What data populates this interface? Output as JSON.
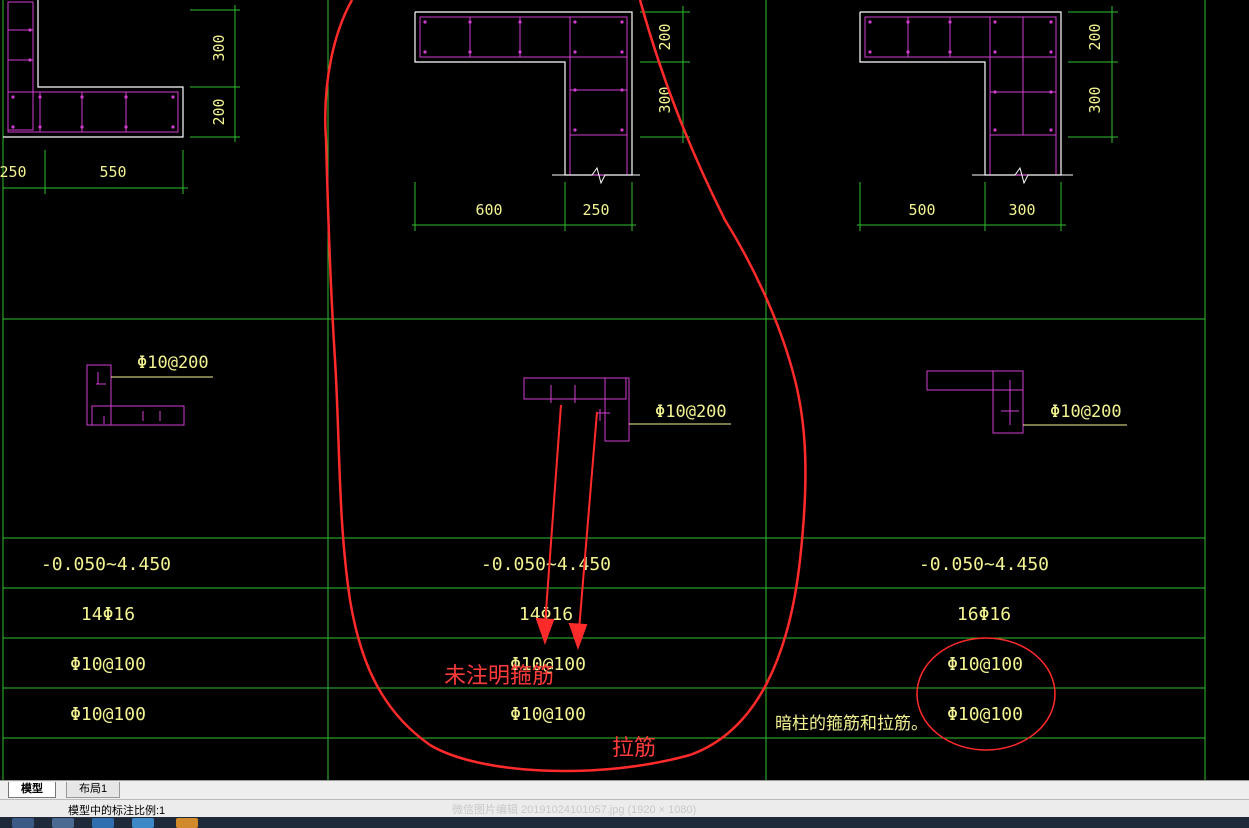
{
  "drawing": {
    "dimensions": {
      "col1": {
        "d300": "300",
        "d200": "200",
        "d250": "250",
        "d550": "550"
      },
      "col2": {
        "d200": "200",
        "d300": "300",
        "d600": "600",
        "d250": "250"
      },
      "col3": {
        "d200": "200",
        "d300": "300",
        "d500": "500",
        "d300b": "300"
      }
    },
    "stirrup_labels": [
      "Φ10@200",
      "Φ10@200",
      "Φ10@200"
    ],
    "table": {
      "elevation": [
        "-0.050~4.450",
        "-0.050~4.450",
        "-0.050~4.450"
      ],
      "longitudinal": [
        "14Φ16",
        "14Φ16",
        "16Φ16"
      ],
      "stirrup": [
        "Φ10@100",
        "Φ10@100",
        "Φ10@100"
      ],
      "tie": [
        "Φ10@100",
        "Φ10@100",
        "Φ10@100"
      ]
    },
    "annotations": {
      "unmarked_stirrup": "未注明箍筋",
      "tie_bar": "拉筋",
      "hidden_column_note": "暗柱的箍筋和拉筋。"
    },
    "colors": {
      "background": "#000000",
      "grid": "#2fbf2f",
      "rebar": "#d23cd2",
      "outline": "#ffffff",
      "text": "#f3f392",
      "markup": "#ff2a2a"
    }
  },
  "tabs": [
    {
      "label": "模型",
      "active": true
    },
    {
      "label": "布局1",
      "active": false
    }
  ],
  "status": {
    "scale": "模型中的标注比例:1",
    "caption": "微信图片编辑 20191024101057.jpg (1920 × 1080)"
  }
}
